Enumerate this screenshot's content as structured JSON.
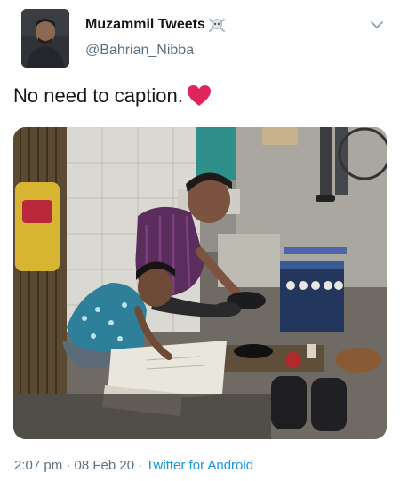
{
  "tweet": {
    "author": {
      "display_name": "Muzammil Tweets",
      "handle": "@Bahrian_Nibba",
      "name_emoji_icon": "skull-and-crossbones-icon",
      "avatar_icon": "profile-photo"
    },
    "text": "No need to caption.",
    "text_emoji_icon": "red-heart-icon",
    "menu_icon": "chevron-down-icon",
    "media": {
      "type": "photo"
    },
    "meta": {
      "time": "2:07 pm",
      "separator": "·",
      "date": "08 Feb 20",
      "source": "Twitter for Android"
    }
  },
  "colors": {
    "text_primary": "#14171a",
    "text_secondary": "#5b7083",
    "link_blue": "#1b95e0",
    "heart_red": "#e0245e"
  }
}
